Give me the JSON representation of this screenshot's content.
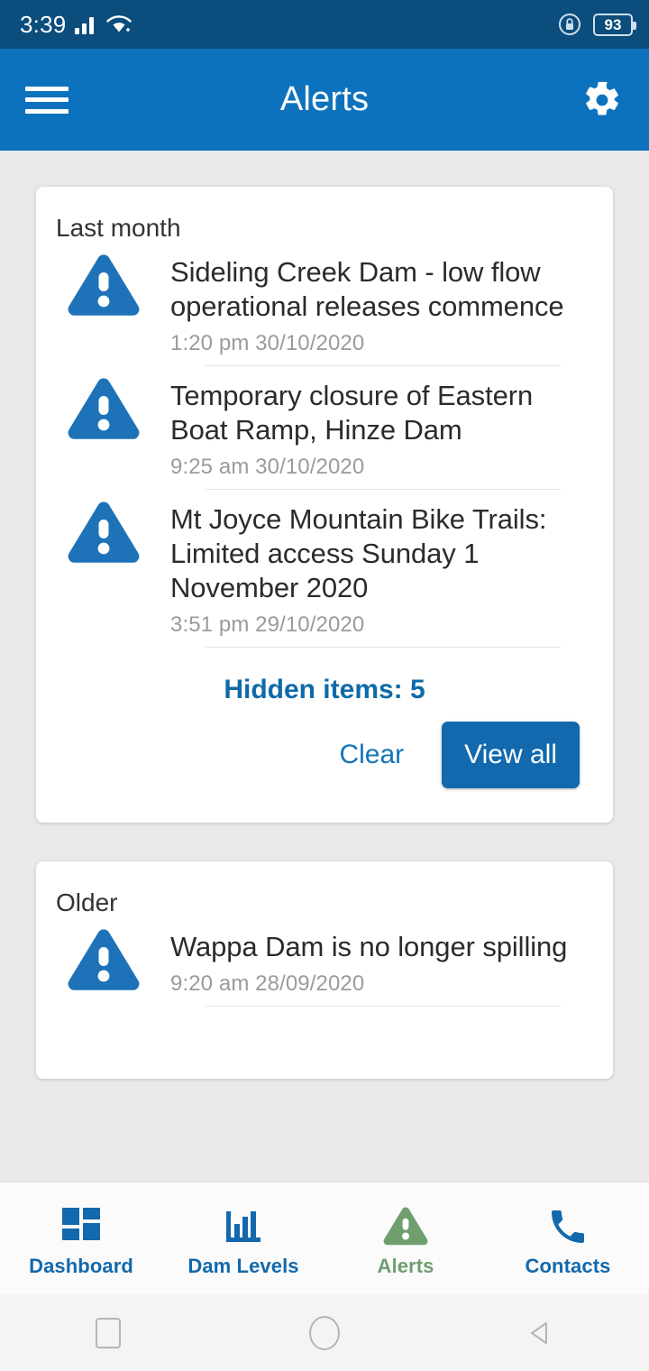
{
  "statusbar": {
    "time": "3:39",
    "signal_icon": "cellular-signal-icon",
    "wifi_icon": "wifi-icon",
    "rotation_lock_icon": "rotation-lock-icon",
    "battery_icon": "battery-icon",
    "battery_level": "93"
  },
  "appbar": {
    "menu_icon": "hamburger-menu-icon",
    "title": "Alerts",
    "settings_icon": "gear-icon"
  },
  "sections": [
    {
      "heading": "Last month",
      "alerts": [
        {
          "icon": "warning-triangle-icon",
          "title": "Sideling Creek Dam - low flow operational releases commence",
          "time": "1:20 pm 30/10/2020"
        },
        {
          "icon": "warning-triangle-icon",
          "title": "Temporary closure of Eastern Boat Ramp, Hinze Dam",
          "time": "9:25 am 30/10/2020"
        },
        {
          "icon": "warning-triangle-icon",
          "title": "Mt Joyce Mountain Bike Trails: Limited access Sunday 1 November 2020",
          "time": "3:51 pm 29/10/2020"
        }
      ],
      "hidden_items_label": "Hidden items: 5",
      "clear_label": "Clear",
      "view_all_label": "View all"
    },
    {
      "heading": "Older",
      "alerts": [
        {
          "icon": "warning-triangle-icon",
          "title": "Wappa Dam is no longer spilling",
          "time": "9:20 am 28/09/2020"
        }
      ]
    }
  ],
  "bottomnav": {
    "items": [
      {
        "label": "Dashboard",
        "icon": "dashboard-grid-icon",
        "active": false
      },
      {
        "label": "Dam Levels",
        "icon": "bar-chart-icon",
        "active": false
      },
      {
        "label": "Alerts",
        "icon": "warning-triangle-icon",
        "active": true
      },
      {
        "label": "Contacts",
        "icon": "phone-icon",
        "active": false
      }
    ]
  },
  "sysnav": {
    "recents_icon": "square-recents-icon",
    "home_icon": "circle-home-icon",
    "back_icon": "triangle-back-icon"
  },
  "colors": {
    "statusbar_bg": "#0b4d7d",
    "appbar_bg": "#0d72bd",
    "page_bg": "#e9e9e9",
    "card_bg": "#ffffff",
    "accent_blue": "#1269ad",
    "link_blue": "#1275b8",
    "alert_icon_blue": "#1e72b8",
    "active_tab_green": "#6f9e6f",
    "muted_text": "#9b9b9b"
  }
}
